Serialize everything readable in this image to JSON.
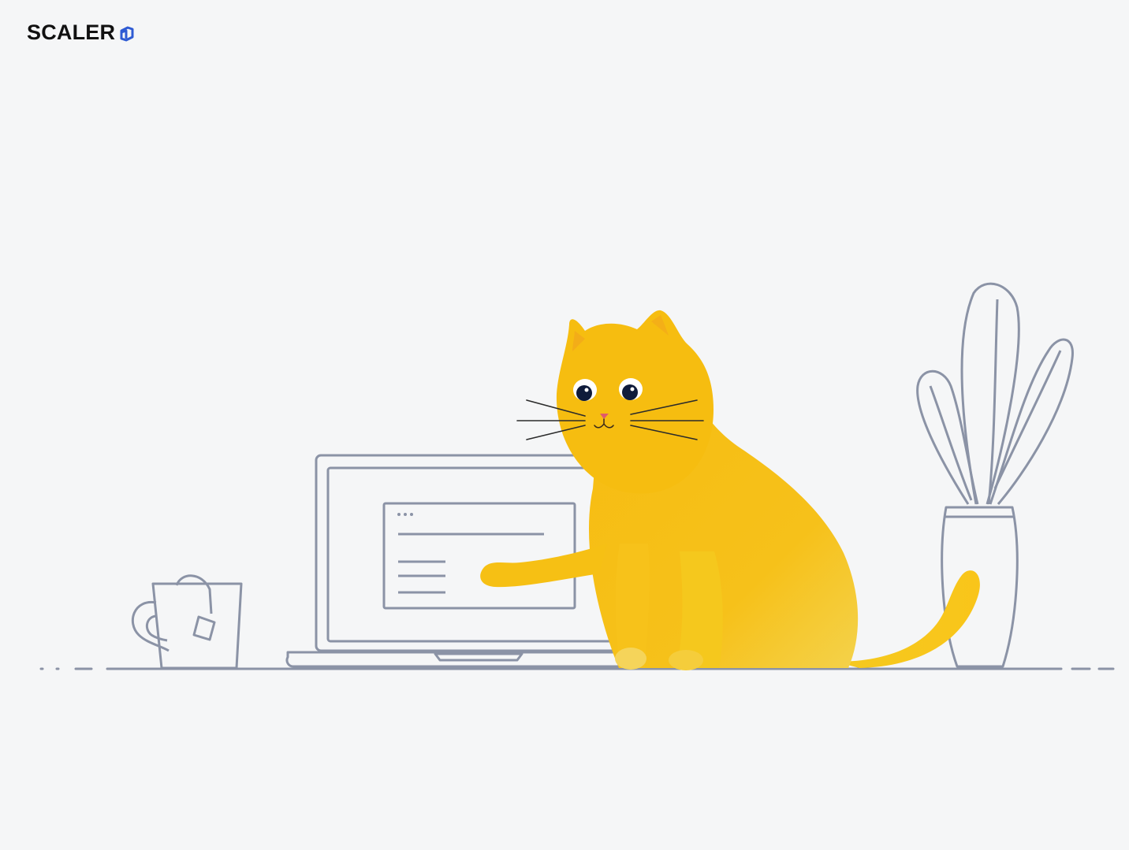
{
  "brand": {
    "name": "SCALER",
    "accent": "#2f5bd3",
    "icon": "scaler-logo-mark-icon"
  },
  "illustration": {
    "cat_color": "#f6bd10",
    "line_color": "#8b93a6",
    "icons": [
      "cat-illustration-icon",
      "laptop-icon",
      "mug-icon",
      "teabag-icon",
      "plant-vase-icon"
    ]
  }
}
